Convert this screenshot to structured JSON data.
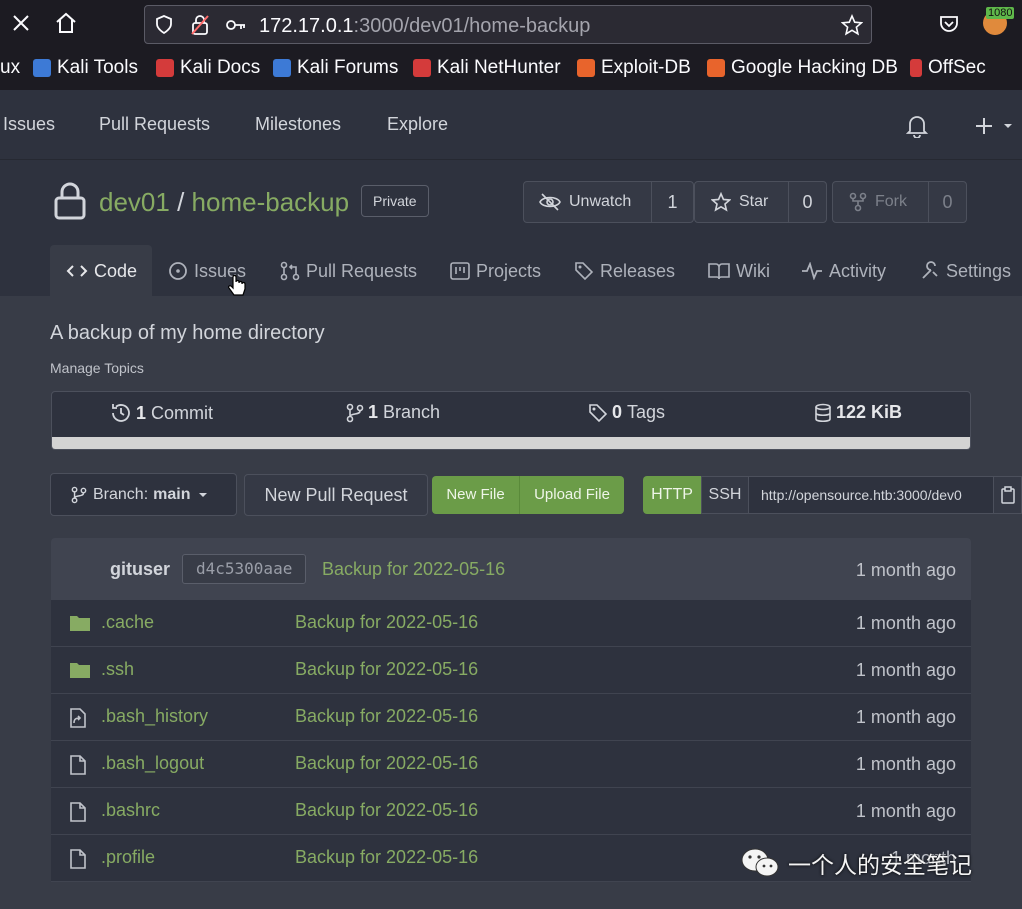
{
  "browser": {
    "url_host": "172.17.0.1",
    "url_rest": ":3000/dev01/home-backup",
    "ext_badge": "1080",
    "bookmarks": [
      "ux",
      "Kali Tools",
      "Kali Docs",
      "Kali Forums",
      "Kali NetHunter",
      "Exploit-DB",
      "Google Hacking DB",
      "OffSec"
    ]
  },
  "nav": {
    "links": [
      "Issues",
      "Pull Requests",
      "Milestones",
      "Explore"
    ]
  },
  "repo": {
    "owner": "dev01",
    "separator": "/",
    "name": "home-backup",
    "badge": "Private",
    "unwatch_label": "Unwatch",
    "unwatch_count": "1",
    "star_label": "Star",
    "star_count": "0",
    "fork_label": "Fork",
    "fork_count": "0",
    "description": "A backup of my home directory",
    "manage_topics": "Manage Topics"
  },
  "tabs": [
    "Code",
    "Issues",
    "Pull Requests",
    "Projects",
    "Releases",
    "Wiki",
    "Activity",
    "Settings"
  ],
  "stats": {
    "commits_num": "1",
    "commits_label": "Commit",
    "branches_num": "1",
    "branches_label": "Branch",
    "tags_num": "0",
    "tags_label": "Tags",
    "size": "122 KiB"
  },
  "toolbar": {
    "branch_prefix": "Branch:",
    "branch_name": "main",
    "new_pr": "New Pull Request",
    "new_file": "New File",
    "upload_file": "Upload File",
    "http": "HTTP",
    "ssh": "SSH",
    "clone_url": "http://opensource.htb:3000/dev0"
  },
  "commit": {
    "user": "gituser",
    "sha": "d4c5300aae",
    "message": "Backup for 2022-05-16",
    "age": "1 month ago"
  },
  "files": [
    {
      "name": ".cache",
      "type": "folder",
      "message": "Backup for 2022-05-16",
      "age": "1 month ago"
    },
    {
      "name": ".ssh",
      "type": "folder",
      "message": "Backup for 2022-05-16",
      "age": "1 month ago"
    },
    {
      "name": ".bash_history",
      "type": "symlink",
      "message": "Backup for 2022-05-16",
      "age": "1 month ago"
    },
    {
      "name": ".bash_logout",
      "type": "file",
      "message": "Backup for 2022-05-16",
      "age": "1 month ago"
    },
    {
      "name": ".bashrc",
      "type": "file",
      "message": "Backup for 2022-05-16",
      "age": "1 month ago"
    },
    {
      "name": ".profile",
      "type": "file",
      "message": "Backup for 2022-05-16",
      "age": "1 month"
    }
  ],
  "watermark": "一个人的安全笔记",
  "colors": {
    "accent_green": "#87ab63",
    "button_green": "#6b9c48",
    "background": "#383c47"
  }
}
